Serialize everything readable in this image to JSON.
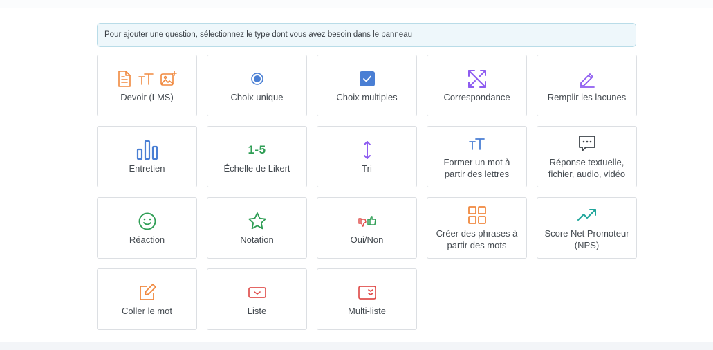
{
  "notice": "Pour ajouter une question, sélectionnez le type dont vous avez besoin dans le panneau",
  "cards": [
    {
      "label": "Devoir (LMS)",
      "icon": "assignment-icons"
    },
    {
      "label": "Choix unique",
      "icon": "radio-icon"
    },
    {
      "label": "Choix multiples",
      "icon": "checkbox-icon"
    },
    {
      "label": "Correspondance",
      "icon": "match-arrows-icon"
    },
    {
      "label": "Remplir les lacunes",
      "icon": "pencil-icon"
    },
    {
      "label": "Entretien",
      "icon": "bar-chart-icon"
    },
    {
      "label": "Échelle de Likert",
      "icon": "likert-icon",
      "icon_text": "1-5"
    },
    {
      "label": "Tri",
      "icon": "sort-arrows-icon"
    },
    {
      "label": "Former un mot à partir des lettres",
      "icon": "text-size-icon"
    },
    {
      "label": "Réponse textuelle, fichier, audio, vidéo",
      "icon": "comment-icon"
    },
    {
      "label": "Réaction",
      "icon": "smile-icon"
    },
    {
      "label": "Notation",
      "icon": "star-icon"
    },
    {
      "label": "Oui/Non",
      "icon": "thumbs-icon"
    },
    {
      "label": "Créer des phrases à partir des mots",
      "icon": "grid-icon"
    },
    {
      "label": "Score Net Promoteur (NPS)",
      "icon": "trending-up-icon"
    },
    {
      "label": "Coller le mot",
      "icon": "edit-square-icon"
    },
    {
      "label": "Liste",
      "icon": "dropdown-icon"
    },
    {
      "label": "Multi-liste",
      "icon": "multi-dropdown-icon"
    }
  ],
  "colors": {
    "orange": "#f0883e",
    "blue": "#4a7fd4",
    "purple": "#8e5cf0",
    "green": "#2f9e55",
    "teal": "#1ea59a",
    "red": "#e0504e",
    "dark": "#3d4349"
  }
}
